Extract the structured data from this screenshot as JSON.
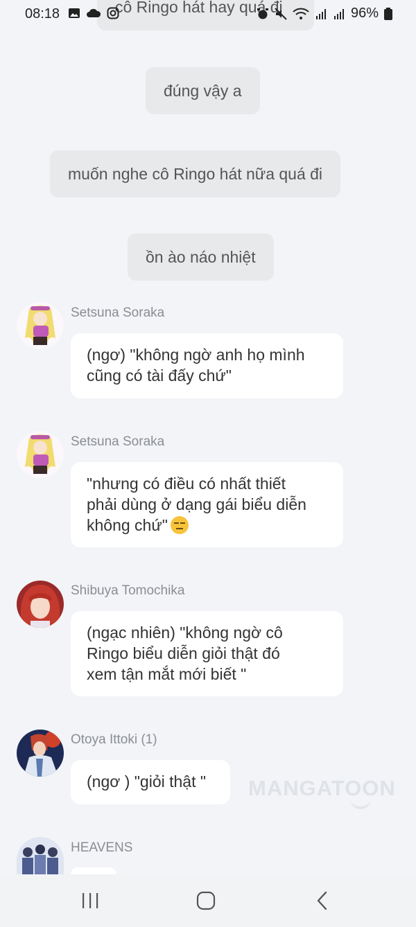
{
  "status_bar": {
    "time": "08:18",
    "battery": "96%"
  },
  "narrations": [
    "cô Ringo hát hay quá đi",
    "đúng vậy a",
    "muốn nghe cô Ringo hát nữa quá đi",
    "ồn ào náo nhiệt"
  ],
  "messages": [
    {
      "sender": "Setsuna Soraka",
      "lines": [
        "(ngơ) \"không ngờ anh họ mình",
        "cũng có tài đấy chứ\""
      ]
    },
    {
      "sender": "Setsuna Soraka",
      "lines": [
        "\"nhưng có điều có nhất thiết",
        "phải dùng ở dạng gái biểu diễn",
        "không chứ\""
      ]
    },
    {
      "sender": "Shibuya Tomochika",
      "lines": [
        "(ngạc nhiên) \"không ngờ cô",
        "Ringo biểu diễn giỏi thật đó",
        "xem tận mắt mới biết \""
      ]
    },
    {
      "sender": "Otoya Ittoki (1)",
      "lines": [
        "(ngơ ) \"giỏi thật \""
      ]
    },
    {
      "sender": "HEAVENS",
      "lines": []
    }
  ],
  "watermark": "MANGATOON",
  "colors": {
    "background": "#f2f4f7",
    "narration_bubble": "#e8e9eb",
    "message_bubble": "#ffffff",
    "sender_text": "#8a8d93"
  }
}
